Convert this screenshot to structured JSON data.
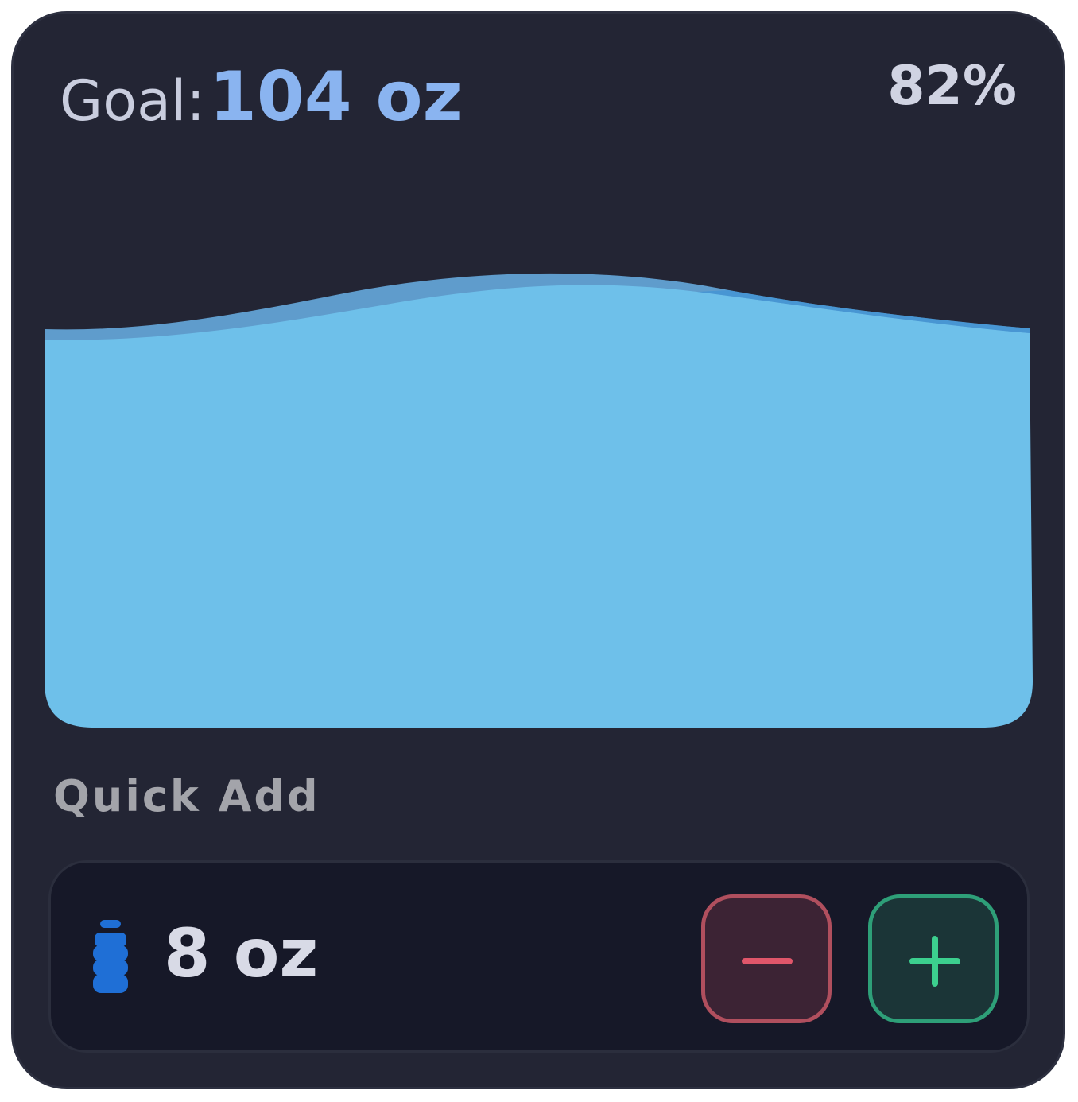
{
  "header": {
    "goal_label": "Goal:",
    "goal_value": "104 oz",
    "percent": "82%"
  },
  "progress": {
    "fraction": 0.82
  },
  "quick_add": {
    "title": "Quick Add",
    "amount": "8 oz",
    "icon": "water-bottle-icon",
    "decrease_icon": "minus-icon",
    "increase_icon": "plus-icon"
  },
  "colors": {
    "background": "#232534",
    "accent": "#8ab4f0",
    "water": "#6ec0ea",
    "decrease": "#b04f5e",
    "increase": "#2e9f78"
  }
}
